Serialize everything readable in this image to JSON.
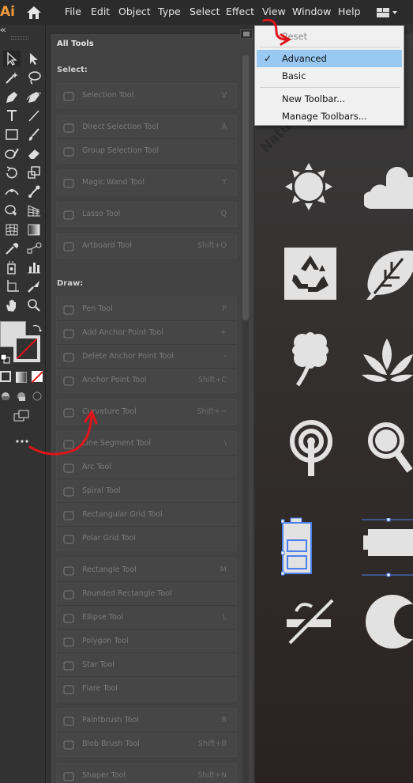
{
  "app": {
    "logo_text": "Ai"
  },
  "menu": [
    "File",
    "Edit",
    "Object",
    "Type",
    "Select",
    "Effect",
    "View",
    "Window",
    "Help"
  ],
  "panel": {
    "title": "All Tools",
    "sections": [
      {
        "title": "Select:",
        "groups": [
          [
            {
              "label": "Selection Tool",
              "shortcut": "V",
              "icon": "selection-tool-icon"
            }
          ],
          [
            {
              "label": "Direct Selection Tool",
              "shortcut": "A",
              "icon": "direct-selection-tool-icon"
            },
            {
              "label": "Group Selection Tool",
              "shortcut": "",
              "icon": "group-selection-tool-icon"
            }
          ],
          [
            {
              "label": "Magic Wand Tool",
              "shortcut": "Y",
              "icon": "magic-wand-tool-icon"
            }
          ],
          [
            {
              "label": "Lasso Tool",
              "shortcut": "Q",
              "icon": "lasso-tool-icon"
            }
          ],
          [
            {
              "label": "Artboard Tool",
              "shortcut": "Shift+O",
              "icon": "artboard-tool-icon"
            }
          ]
        ]
      },
      {
        "title": "Draw:",
        "groups": [
          [
            {
              "label": "Pen Tool",
              "shortcut": "P",
              "icon": "pen-tool-icon"
            },
            {
              "label": "Add Anchor Point Tool",
              "shortcut": "+",
              "icon": "add-anchor-point-tool-icon"
            },
            {
              "label": "Delete Anchor Point Tool",
              "shortcut": "-",
              "icon": "delete-anchor-point-tool-icon"
            },
            {
              "label": "Anchor Point Tool",
              "shortcut": "Shift+C",
              "icon": "anchor-point-tool-icon"
            }
          ],
          [
            {
              "label": "Curvature Tool",
              "shortcut": "Shift+~",
              "icon": "curvature-tool-icon"
            }
          ],
          [
            {
              "label": "Line Segment Tool",
              "shortcut": "\\",
              "icon": "line-segment-tool-icon"
            },
            {
              "label": "Arc Tool",
              "shortcut": "",
              "icon": "arc-tool-icon"
            },
            {
              "label": "Spiral Tool",
              "shortcut": "",
              "icon": "spiral-tool-icon"
            },
            {
              "label": "Rectangular Grid Tool",
              "shortcut": "",
              "icon": "rectangular-grid-tool-icon"
            },
            {
              "label": "Polar Grid Tool",
              "shortcut": "",
              "icon": "polar-grid-tool-icon"
            }
          ],
          [
            {
              "label": "Rectangle Tool",
              "shortcut": "M",
              "icon": "rectangle-tool-icon"
            },
            {
              "label": "Rounded Rectangle Tool",
              "shortcut": "",
              "icon": "rounded-rectangle-tool-icon"
            },
            {
              "label": "Ellipse Tool",
              "shortcut": "L",
              "icon": "ellipse-tool-icon"
            },
            {
              "label": "Polygon Tool",
              "shortcut": "",
              "icon": "polygon-tool-icon"
            },
            {
              "label": "Star Tool",
              "shortcut": "",
              "icon": "star-tool-icon"
            },
            {
              "label": "Flare Tool",
              "shortcut": "",
              "icon": "flare-tool-icon"
            }
          ],
          [
            {
              "label": "Paintbrush Tool",
              "shortcut": "B",
              "icon": "paintbrush-tool-icon"
            },
            {
              "label": "Blob Brush Tool",
              "shortcut": "Shift+B",
              "icon": "blob-brush-tool-icon"
            }
          ],
          [
            {
              "label": "Shaper Tool",
              "shortcut": "Shift+N",
              "icon": "shaper-tool-icon"
            }
          ]
        ]
      }
    ]
  },
  "dropdown": {
    "reset": "Reset",
    "advanced": "Advanced",
    "basic": "Basic",
    "new_toolbar": "New Toolbar...",
    "manage_toolbars": "Manage Toolbars...",
    "checked": "Advanced"
  },
  "artboard": {
    "badge": "Nature"
  },
  "colors": {
    "accent": "#f29b3d",
    "selection": "#99c9f3",
    "annotation": "#e0151b",
    "bounding_box": "#4a7ff0"
  }
}
